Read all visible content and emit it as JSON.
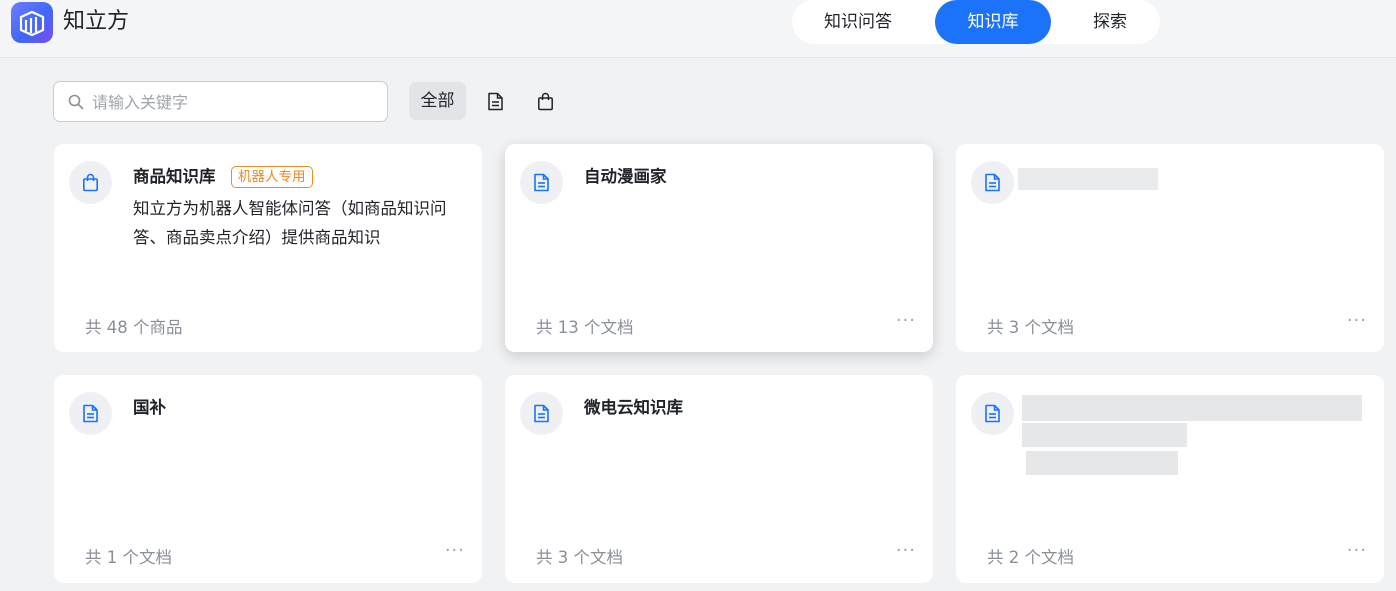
{
  "app": {
    "title": "知立方"
  },
  "nav": {
    "tabs": [
      {
        "label": "知识问答",
        "active": false
      },
      {
        "label": "知识库",
        "active": true
      },
      {
        "label": "探索",
        "active": false
      }
    ]
  },
  "toolbar": {
    "search_placeholder": "请输入关键字",
    "search_value": "",
    "filter_all_label": "全部",
    "filter_icons": [
      "document-icon",
      "shopping-bag-icon"
    ]
  },
  "colors": {
    "accent": "#1a73f8",
    "badge": "#f08a24",
    "muted": "#8a8f99"
  },
  "cards": [
    {
      "icon": "shopping-bag-icon",
      "title": "商品知识库",
      "badge": "机器人专用",
      "description": "知立方为机器人智能体问答（如商品知识问答、商品卖点介绍）提供商品知识",
      "count": "共 48 个商品",
      "more": ""
    },
    {
      "icon": "document-icon",
      "title": "自动漫画家",
      "badge": "",
      "description": "",
      "count": "共 13 个文档",
      "more": "···"
    },
    {
      "icon": "document-icon",
      "title": "",
      "badge": "",
      "description": "",
      "count": "共 3 个文档",
      "more": "···"
    },
    {
      "icon": "document-icon",
      "title": "国补",
      "badge": "",
      "description": "",
      "count": "共 1 个文档",
      "more": "···"
    },
    {
      "icon": "document-icon",
      "title": "微电云知识库",
      "badge": "",
      "description": "",
      "count": "共 3 个文档",
      "more": "···"
    },
    {
      "icon": "document-icon",
      "title": "",
      "badge": "",
      "description": "",
      "count": "共 2 个文档",
      "more": "···"
    }
  ]
}
